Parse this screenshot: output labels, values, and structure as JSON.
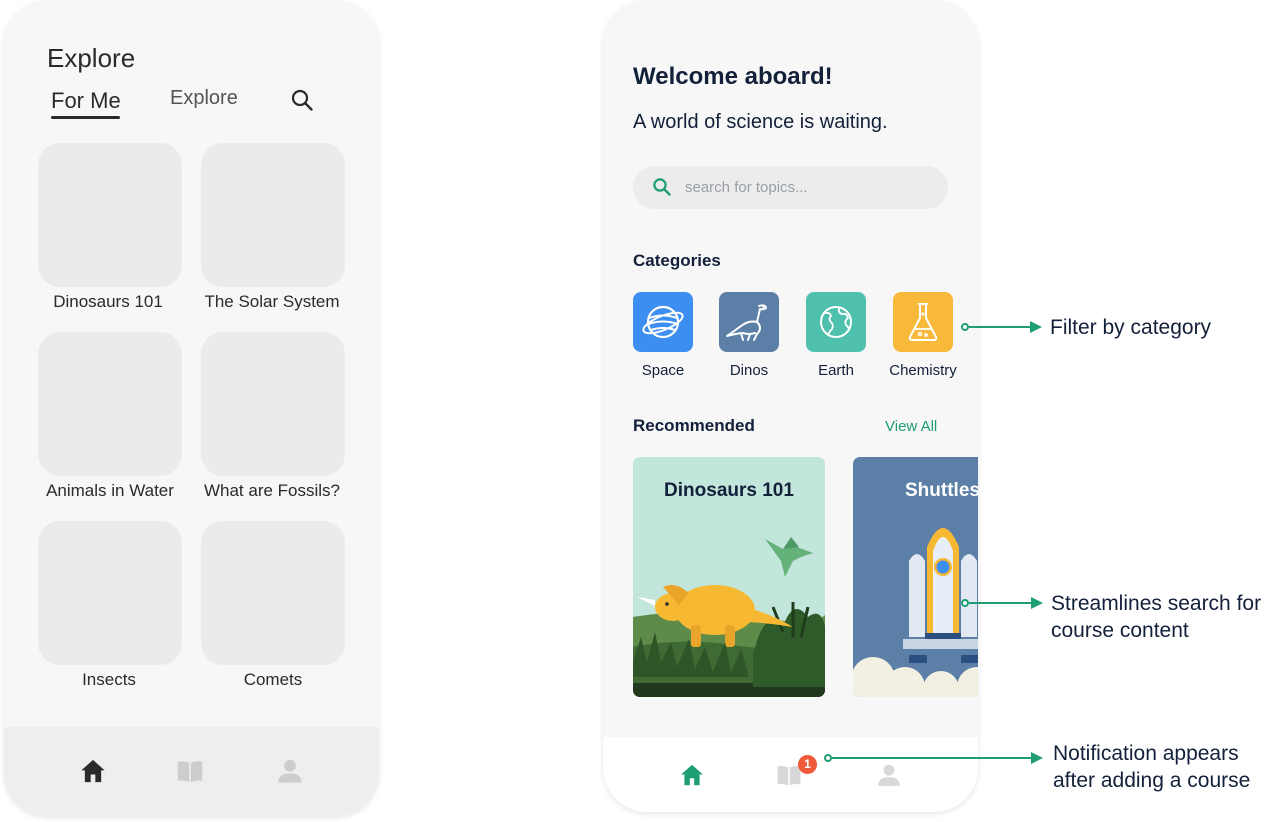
{
  "left_phone": {
    "title": "Explore",
    "tabs": [
      {
        "label": "For Me",
        "active": true
      },
      {
        "label": "Explore",
        "active": false
      }
    ],
    "tiles": [
      {
        "label": "Dinosaurs 101"
      },
      {
        "label": "The Solar System"
      },
      {
        "label": "Animals in Water"
      },
      {
        "label": "What are Fossils?"
      },
      {
        "label": "Insects"
      },
      {
        "label": "Comets"
      }
    ],
    "nav": [
      {
        "icon": "home-icon",
        "active": true
      },
      {
        "icon": "book-icon",
        "active": false
      },
      {
        "icon": "user-icon",
        "active": false
      }
    ]
  },
  "right_phone": {
    "welcome": "Welcome aboard!",
    "subtitle": "A world of science is waiting.",
    "search": {
      "placeholder": "search for topics..."
    },
    "categories_heading": "Categories",
    "categories": [
      {
        "label": "Space",
        "icon": "planet-icon",
        "color": "#3c8ff0"
      },
      {
        "label": "Dinos",
        "icon": "dinosaur-icon",
        "color": "#5b7fa6"
      },
      {
        "label": "Earth",
        "icon": "globe-icon",
        "color": "#4fc0ad"
      },
      {
        "label": "Chemistry",
        "icon": "flask-icon",
        "color": "#f8b93a"
      }
    ],
    "recommended_heading": "Recommended",
    "view_all": "View All",
    "cards": [
      {
        "title": "Dinosaurs 101",
        "bg": "#c3e6dc"
      },
      {
        "title": "Shuttles",
        "bg": "#5b7fa6"
      }
    ],
    "nav": [
      {
        "icon": "home-icon",
        "active": true
      },
      {
        "icon": "book-icon",
        "active": false,
        "badge": "1"
      },
      {
        "icon": "user-icon",
        "active": false
      }
    ],
    "accent": "#1e9e72",
    "badge_color": "#ee5a3a"
  },
  "annotations": [
    {
      "text": "Filter by category"
    },
    {
      "text": "Streamlines search for course content"
    },
    {
      "text": "Notification appears after adding a course"
    }
  ]
}
